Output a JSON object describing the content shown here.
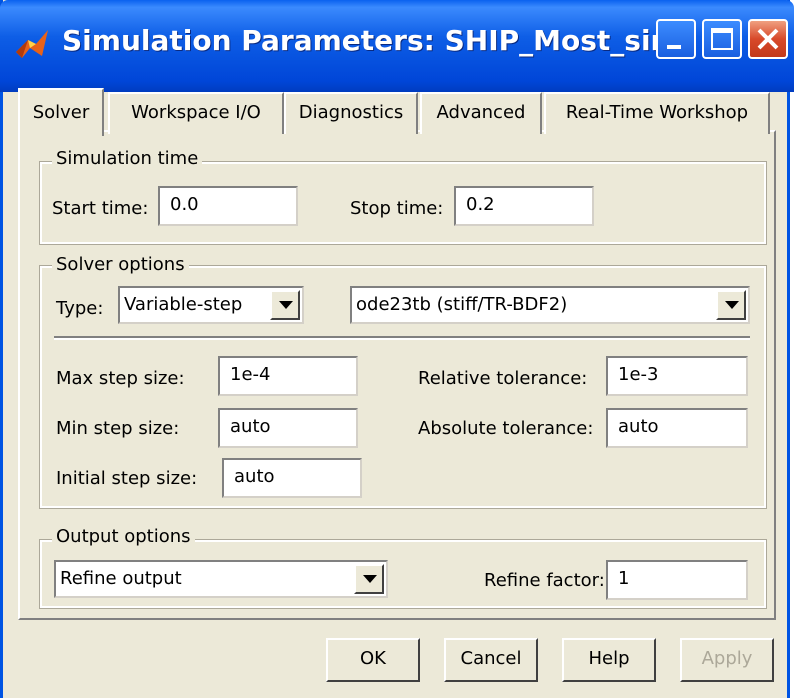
{
  "window": {
    "title": "Simulation Parameters: SHIP_Most_sim"
  },
  "tabs": [
    {
      "label": "Solver"
    },
    {
      "label": "Workspace I/O"
    },
    {
      "label": "Diagnostics"
    },
    {
      "label": "Advanced"
    },
    {
      "label": "Real-Time Workshop"
    }
  ],
  "simulation_time": {
    "legend": "Simulation time",
    "start_label": "Start time:",
    "start_value": "0.0",
    "stop_label": "Stop time:",
    "stop_value": "0.2"
  },
  "solver_options": {
    "legend": "Solver options",
    "type_label": "Type:",
    "type_value": "Variable-step",
    "solver_value": "ode23tb (stiff/TR-BDF2)",
    "max_step_label": "Max step size:",
    "max_step_value": "1e-4",
    "min_step_label": "Min step size:",
    "min_step_value": "auto",
    "initial_step_label": "Initial step size:",
    "initial_step_value": "auto",
    "rel_tol_label": "Relative tolerance:",
    "rel_tol_value": "1e-3",
    "abs_tol_label": "Absolute tolerance:",
    "abs_tol_value": "auto"
  },
  "output_options": {
    "legend": "Output options",
    "output_value": "Refine output",
    "refine_label": "Refine factor:",
    "refine_value": "1"
  },
  "buttons": {
    "ok": "OK",
    "cancel": "Cancel",
    "help": "Help",
    "apply": "Apply"
  },
  "colors": {
    "titlebar": "#0054e3",
    "dialog_bg": "#ece9d8",
    "close_button": "#d8492a"
  }
}
